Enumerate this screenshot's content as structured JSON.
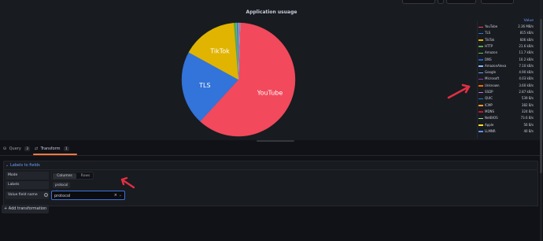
{
  "panel": {
    "title": "Application usuage",
    "legend_header": "Value"
  },
  "chart_data": {
    "type": "pie",
    "title": "Application usuage",
    "slices": [
      {
        "label": "YouTube",
        "value": 2.36,
        "unit": "MB/s",
        "color": "#f2495c"
      },
      {
        "label": "TLS",
        "value": 815,
        "unit": "kB/s",
        "color": "#3274d9"
      },
      {
        "label": "TikTok",
        "value": 606,
        "unit": "kB/s",
        "color": "#e0b400"
      },
      {
        "label": "HTTP",
        "value": 21.6,
        "unit": "kB/s",
        "color": "#56a64b"
      },
      {
        "label": "Amazon",
        "value": 11.7,
        "unit": "kB/s",
        "color": "#73bf69"
      },
      {
        "label": "DNS",
        "value": 10.2,
        "unit": "kB/s",
        "color": "#1f60c4"
      },
      {
        "label": "AmazonAlexa",
        "value": 7.1,
        "unit": "kB/s",
        "color": "#8ab8ff"
      },
      {
        "label": "Google",
        "value": 4.9,
        "unit": "kB/s",
        "color": "#6e9fff"
      },
      {
        "label": "Microsoft",
        "value": 4.03,
        "unit": "kB/s",
        "color": "#8f3bb8"
      },
      {
        "label": "Unknown",
        "value": 3.6,
        "unit": "kB/s",
        "color": "#fa6400"
      },
      {
        "label": "SSDP",
        "value": 2.87,
        "unit": "kB/s",
        "color": "#b877d9"
      },
      {
        "label": "QUIC",
        "value": 0.539,
        "unit": "kB/s",
        "color": "#1f78c1"
      },
      {
        "label": "ICMP",
        "value": 0.382,
        "unit": "kB/s",
        "color": "#ff9830"
      },
      {
        "label": "MDNS",
        "value": 0.324,
        "unit": "kB/s",
        "color": "#c4162a"
      },
      {
        "label": "NetBIOS",
        "value": 0.0736,
        "unit": "kB/s",
        "color": "#96d98d"
      },
      {
        "label": "Apple",
        "value": 0.056,
        "unit": "kB/s",
        "color": "#fade2a"
      },
      {
        "label": "LLMNR",
        "value": 0.04,
        "unit": "kB/s",
        "color": "#5794f2"
      }
    ]
  },
  "legend": [
    {
      "name": "YouTube",
      "value": "2.36 MB/s",
      "color": "#f2495c"
    },
    {
      "name": "TLS",
      "value": "815 kB/s",
      "color": "#3274d9"
    },
    {
      "name": "TikTok",
      "value": "606 kB/s",
      "color": "#e0b400"
    },
    {
      "name": "HTTP",
      "value": "21.6 kB/s",
      "color": "#56a64b"
    },
    {
      "name": "Amazon",
      "value": "11.7 kB/s",
      "color": "#73bf69"
    },
    {
      "name": "DNS",
      "value": "10.2 kB/s",
      "color": "#1f60c4"
    },
    {
      "name": "AmazonAlexa",
      "value": "7.10 kB/s",
      "color": "#8ab8ff"
    },
    {
      "name": "Google",
      "value": "4.90 kB/s",
      "color": "#6e9fff"
    },
    {
      "name": "Microsoft",
      "value": "4.03 kB/s",
      "color": "#8f3bb8"
    },
    {
      "name": "Unknown",
      "value": "3.60 kB/s",
      "color": "#fa6400"
    },
    {
      "name": "SSDP",
      "value": "2.87 kB/s",
      "color": "#b877d9"
    },
    {
      "name": "QUIC",
      "value": "539 B/s",
      "color": "#1f78c1"
    },
    {
      "name": "ICMP",
      "value": "382 B/s",
      "color": "#ff9830"
    },
    {
      "name": "MDNS",
      "value": "324 B/s",
      "color": "#c4162a"
    },
    {
      "name": "NetBIOS",
      "value": "73.6 B/s",
      "color": "#96d98d"
    },
    {
      "name": "Apple",
      "value": "56 B/s",
      "color": "#fade2a"
    },
    {
      "name": "LLMNR",
      "value": "40 B/s",
      "color": "#5794f2"
    }
  ],
  "tabs": [
    {
      "label": "Query",
      "count": "3",
      "icon": "database-icon"
    },
    {
      "label": "Transform",
      "count": "1",
      "icon": "transform-icon"
    }
  ],
  "transform": {
    "title": "Labels to fields",
    "mode_label": "Mode",
    "mode_options": [
      "Columns",
      "Rows"
    ],
    "mode_selected": "Columns",
    "labels_label": "Labels",
    "labels_chip": "protocol",
    "value_field_label": "Value field name",
    "value_field_value": "protocol",
    "add_button": "Add transformation"
  },
  "colors": {
    "accent": "#ff7941",
    "link": "#6e9fff",
    "annotation_arrow": "#e02f44"
  }
}
